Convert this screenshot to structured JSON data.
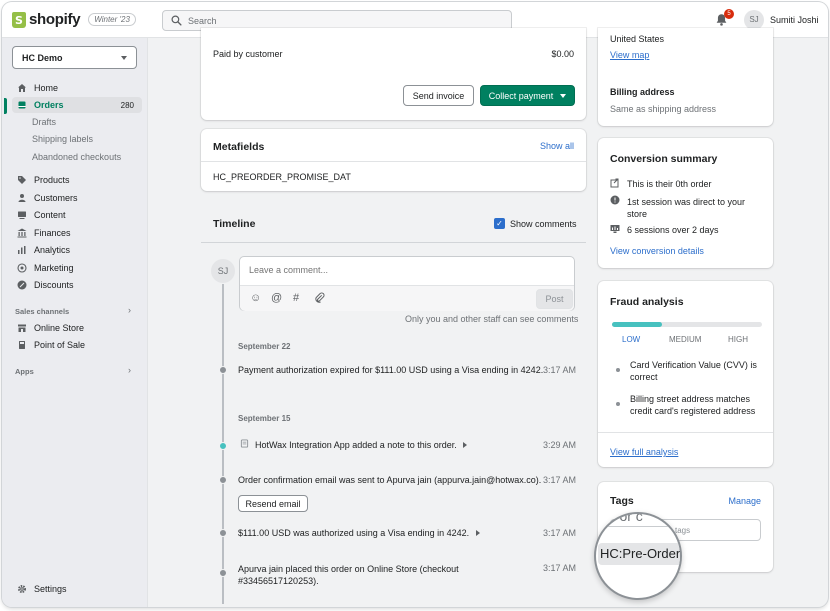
{
  "topbar": {
    "brand": "shopify",
    "edition": "Winter '23",
    "search_placeholder": "Search",
    "notification_count": "5",
    "avatar_initials": "SJ",
    "user_name": "Sumiti Joshi"
  },
  "sidebar": {
    "store_name": "HC Demo",
    "items": [
      {
        "label": "Home",
        "icon": "home-icon"
      },
      {
        "label": "Orders",
        "icon": "orders-icon",
        "count": "280",
        "active": true
      },
      {
        "label": "Products",
        "icon": "tag-icon"
      },
      {
        "label": "Customers",
        "icon": "person-icon"
      },
      {
        "label": "Content",
        "icon": "content-icon"
      },
      {
        "label": "Finances",
        "icon": "bank-icon"
      },
      {
        "label": "Analytics",
        "icon": "bar-chart-icon"
      },
      {
        "label": "Marketing",
        "icon": "target-icon"
      },
      {
        "label": "Discounts",
        "icon": "discount-icon"
      }
    ],
    "order_subitems": [
      "Drafts",
      "Shipping labels",
      "Abandoned checkouts"
    ],
    "sales_channels_label": "Sales channels",
    "channels": [
      "Online Store",
      "Point of Sale"
    ],
    "apps_label": "Apps",
    "settings_label": "Settings"
  },
  "payment": {
    "paid_label": "Paid by customer",
    "paid_amount": "$0.00",
    "send_invoice": "Send invoice",
    "collect_payment": "Collect payment"
  },
  "metafields": {
    "title": "Metafields",
    "show_all": "Show all",
    "value": "HC_PREORDER_PROMISE_DAT"
  },
  "timeline": {
    "title": "Timeline",
    "show_comments": "Show comments",
    "avatar": "SJ",
    "comment_placeholder": "Leave a comment...",
    "post": "Post",
    "staff_note": "Only you and other staff can see comments",
    "groups": [
      {
        "date": "September 22",
        "events": [
          {
            "text": "Payment authorization expired for $111.00 USD using a Visa ending in 4242.",
            "time": "3:17 AM"
          }
        ]
      },
      {
        "date": "September 15",
        "events": [
          {
            "text": "HotWax Integration App added a note to this order.",
            "time": "3:29 AM"
          },
          {
            "text": "Order confirmation email was sent to Apurva jain (appurva.jain@hotwax.co).",
            "time": "3:17 AM",
            "button": "Resend email"
          },
          {
            "text": "$111.00 USD was authorized using a Visa ending in 4242.",
            "time": "3:17 AM"
          },
          {
            "text": "Apurva jain placed this order on Online Store (checkout",
            "text2": "#33456517120253).",
            "time": "3:17 AM"
          }
        ]
      }
    ]
  },
  "address": {
    "country": "United States",
    "view_map": "View map",
    "billing_title": "Billing address",
    "billing_value": "Same as shipping address"
  },
  "conversion": {
    "title": "Conversion summary",
    "items": [
      {
        "icon": "reorder-icon",
        "text": "This is their 0th order"
      },
      {
        "icon": "info-icon",
        "text": "1st session was direct to your",
        "text2": "store"
      },
      {
        "icon": "sessions-icon",
        "text": "6 sessions over 2 days"
      }
    ],
    "details_link": "View conversion details"
  },
  "fraud": {
    "title": "Fraud analysis",
    "risk_level": 0.33,
    "levels": [
      "LOW",
      "MEDIUM",
      "HIGH"
    ],
    "checks": [
      {
        "text": "Card Verification Value (CVV) is",
        "text2": "correct"
      },
      {
        "text": "Billing street address matches",
        "text2": "credit card's registered address"
      }
    ],
    "full_analysis": "View full analysis"
  },
  "tags": {
    "title": "Tags",
    "manage": "Manage",
    "input_placeholder": "tags",
    "find_partial": "nd or c",
    "tag": "HC:Pre-Order"
  },
  "colors": {
    "accent": "#008060",
    "link": "#2c6ecb",
    "risk": "#47c1bf"
  }
}
